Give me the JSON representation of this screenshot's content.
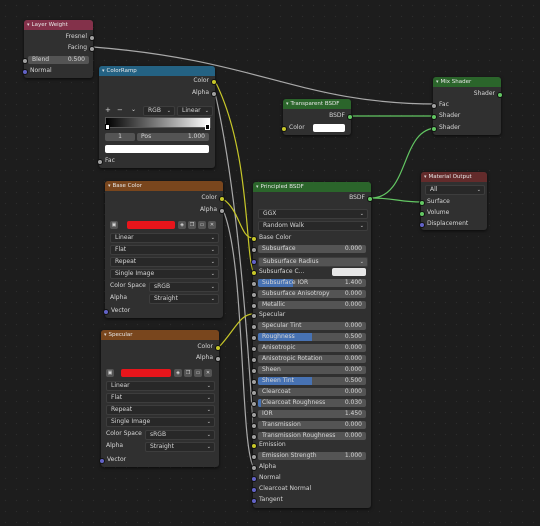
{
  "layer_weight": {
    "title": "Layer Weight",
    "out_fresnel": "Fresnel",
    "out_facing": "Facing",
    "blend_label": "Blend",
    "blend_value": "0.500",
    "in_normal": "Normal"
  },
  "color_ramp": {
    "title": "ColorRamp",
    "out_color": "Color",
    "out_alpha": "Alpha",
    "plus": "+",
    "minus": "−",
    "mode": "RGB",
    "interp": "Linear",
    "stop_index": "1",
    "pos_label": "Pos",
    "pos_value": "1.000",
    "in_fac": "Fac"
  },
  "transparent_bsdf": {
    "title": "Transparent BSDF",
    "out_bsdf": "BSDF",
    "in_color": "Color"
  },
  "mix_shader": {
    "title": "Mix Shader",
    "out_shader": "Shader",
    "in_fac": "Fac",
    "in_shader1": "Shader",
    "in_shader2": "Shader"
  },
  "material_output": {
    "title": "Material Output",
    "target": "All",
    "in_surface": "Surface",
    "in_volume": "Volume",
    "in_displacement": "Displacement"
  },
  "base_color_tex": {
    "title": "Base Color",
    "out_color": "Color",
    "out_alpha": "Alpha",
    "interpolation": "Linear",
    "projection": "Flat",
    "extension": "Repeat",
    "source": "Single Image",
    "cs_label": "Color Space",
    "cs_value": "sRGB",
    "alpha_label": "Alpha",
    "alpha_value": "Straight",
    "in_vector": "Vector"
  },
  "specular_tex": {
    "title": "Specular",
    "out_color": "Color",
    "out_alpha": "Alpha",
    "interpolation": "Linear",
    "projection": "Flat",
    "extension": "Repeat",
    "source": "Single Image",
    "cs_label": "Color Space",
    "cs_value": "sRGB",
    "alpha_label": "Alpha",
    "alpha_value": "Straight",
    "in_vector": "Vector"
  },
  "principled": {
    "title": "Principled BSDF",
    "out_bsdf": "BSDF",
    "distribution": "GGX",
    "subsurface_method": "Random Walk",
    "base_color": "Base Color",
    "subsurface": "Subsurface",
    "subsurface_value": "0.000",
    "subsurface_radius": "Subsurface Radius",
    "subsurface_color": "Subsurface C...",
    "subsurface_ior": "Subsurface IOR",
    "subsurface_ior_value": "1.400",
    "subsurface_aniso": "Subsurface Anisotropy",
    "subsurface_aniso_value": "0.000",
    "metallic": "Metallic",
    "metallic_value": "0.000",
    "specular": "Specular",
    "rows": [
      {
        "label": "Specular Tint",
        "value": "0.000",
        "fill": 0
      },
      {
        "label": "Roughness",
        "value": "0.500",
        "fill": 0.5
      },
      {
        "label": "Anisotropic",
        "value": "0.000",
        "fill": 0
      },
      {
        "label": "Anisotropic Rotation",
        "value": "0.000",
        "fill": 0
      },
      {
        "label": "Sheen",
        "value": "0.000",
        "fill": 0
      },
      {
        "label": "Sheen Tint",
        "value": "0.500",
        "fill": 0.5
      },
      {
        "label": "Clearcoat",
        "value": "0.000",
        "fill": 0
      },
      {
        "label": "Clearcoat Roughness",
        "value": "0.030",
        "fill": 0.03
      },
      {
        "label": "IOR",
        "value": "1.450",
        "fill": 0
      },
      {
        "label": "Transmission",
        "value": "0.000",
        "fill": 0
      },
      {
        "label": "Transmission Roughness",
        "value": "0.000",
        "fill": 0
      }
    ],
    "emission": "Emission",
    "emission_strength": "Emission Strength",
    "emission_strength_value": "1.000",
    "alpha": "Alpha",
    "normal": "Normal",
    "clearcoat_normal": "Clearcoat Normal",
    "tangent": "Tangent"
  },
  "colors": {
    "input_header": "#83314a",
    "converter_header": "#246283",
    "texture_header": "#79461d",
    "shader_header": "#2b652b",
    "output_header": "#632b2b",
    "socket_gray": "#a1a1a1",
    "socket_yellow": "#c7c729",
    "socket_green": "#63c763",
    "socket_purple": "#6363c7",
    "slider_fill": "#4772b3"
  }
}
